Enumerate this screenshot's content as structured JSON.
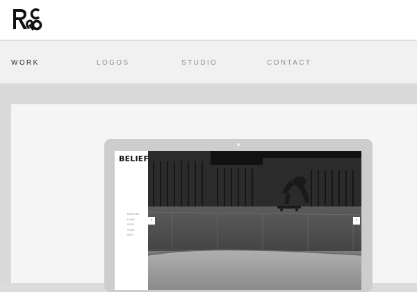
{
  "brand": {
    "logo_icon": "r-and-co-logo"
  },
  "nav": {
    "items": [
      {
        "label": "WORK",
        "active": true
      },
      {
        "label": "LOGOS",
        "active": false
      },
      {
        "label": "STUDIO",
        "active": false
      },
      {
        "label": "CONTACT",
        "active": false
      }
    ]
  },
  "preview": {
    "site_title": "BELIEF",
    "menu_items": [
      "UPDATES",
      "LINKS",
      "SHOP",
      "TEAM",
      "INFO"
    ],
    "prev_label": "‹",
    "next_label": "›"
  },
  "colors": {
    "header_bg": "#ffffff",
    "nav_bg": "#f1f1f1",
    "band_bg": "#d9d9d9",
    "panel_bg": "#f5f5f5",
    "laptop_bezel": "#cdcdcd",
    "nav_active": "#2a2a2a",
    "nav_inactive": "#8e8e8e"
  }
}
